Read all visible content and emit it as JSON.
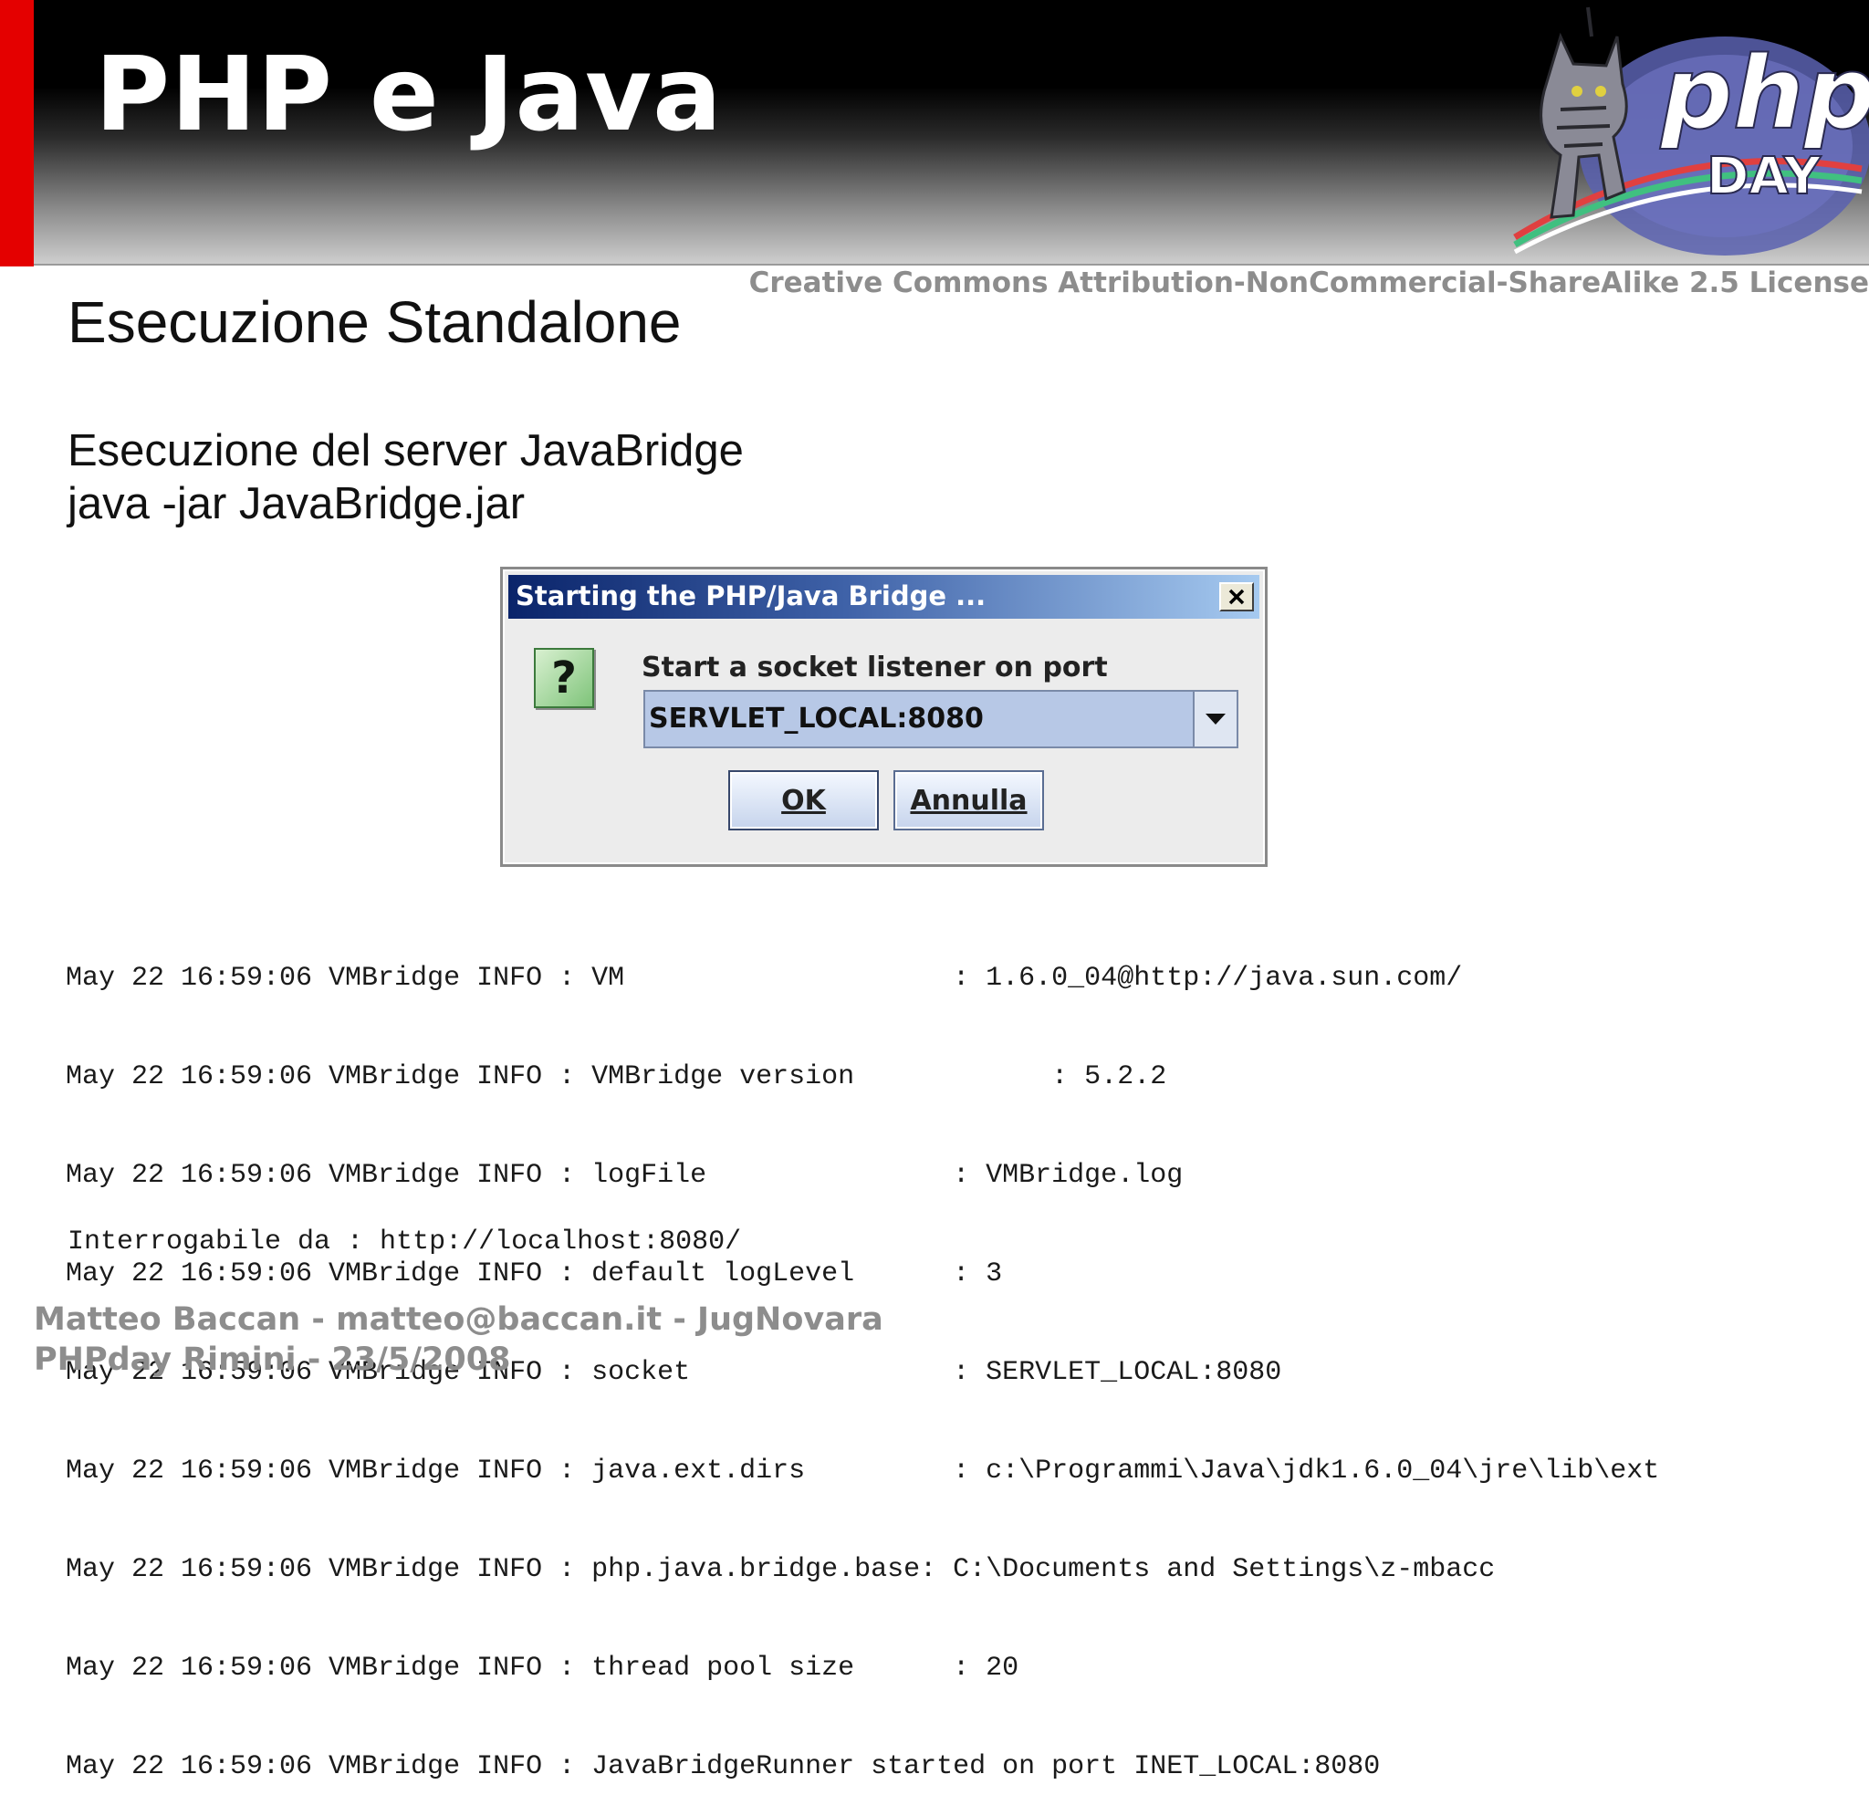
{
  "slide": {
    "title": "PHP e Java",
    "license": "Creative Commons Attribution-NonCommercial-ShareAlike 2.5 License",
    "subtitle": "Esecuzione Standalone",
    "lines": [
      "Esecuzione del server JavaBridge",
      "java -jar JavaBridge.jar"
    ],
    "logo": {
      "word": "php",
      "sub": "DAY"
    },
    "footer": [
      "Matteo Baccan - matteo@baccan.it - JugNovara",
      "PHPday Rimini - 23/5/2008"
    ]
  },
  "dialog": {
    "title": "Starting the PHP/Java Bridge ...",
    "prompt": "Start a socket listener on port",
    "selected_value": "SERVLET_LOCAL:8080",
    "ok_label": "OK",
    "cancel_label": "Annulla",
    "icon": "question-icon"
  },
  "log": {
    "lines": [
      "May 22 16:59:06 VMBridge INFO : VM                    : 1.6.0_04@http://java.sun.com/",
      "May 22 16:59:06 VMBridge INFO : VMBridge version            : 5.2.2",
      "May 22 16:59:06 VMBridge INFO : logFile               : VMBridge.log",
      "May 22 16:59:06 VMBridge INFO : default logLevel      : 3",
      "May 22 16:59:06 VMBridge INFO : socket                : SERVLET_LOCAL:8080",
      "May 22 16:59:06 VMBridge INFO : java.ext.dirs         : c:\\Programmi\\Java\\jdk1.6.0_04\\jre\\lib\\ext",
      "May 22 16:59:06 VMBridge INFO : php.java.bridge.base: C:\\Documents and Settings\\z-mbacc",
      "May 22 16:59:06 VMBridge INFO : thread pool size      : 20",
      "May 22 16:59:06 VMBridge INFO : JavaBridgeRunner started on port INET_LOCAL:8080"
    ],
    "query_line": "Interrogabile da : http://localhost:8080/"
  }
}
